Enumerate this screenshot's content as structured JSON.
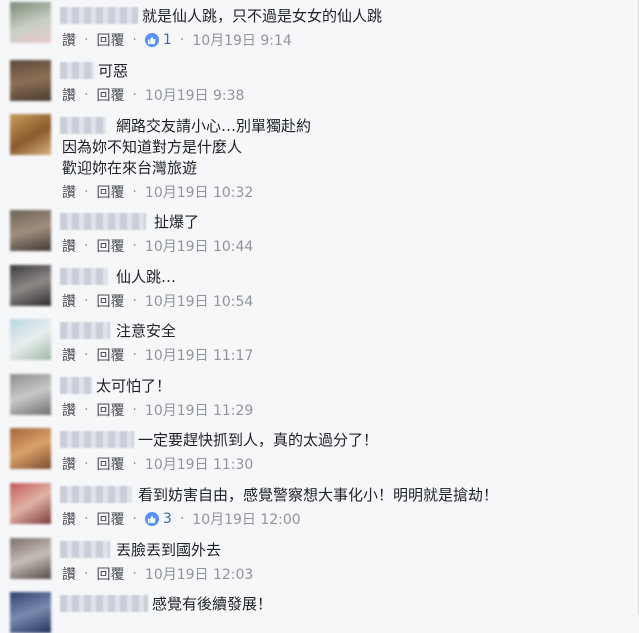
{
  "actions": {
    "like_label": "讚",
    "reply_label": "回覆",
    "separator": "·"
  },
  "comments": [
    {
      "text": "就是仙人跳，只不過是女女的仙人跳",
      "likes": "1",
      "time": "10月19日 9:14"
    },
    {
      "text": "可惡",
      "time": "10月19日 9:38"
    },
    {
      "text": "網路交友請小心…別單獨赴約",
      "text2": "因為妳不知道對方是什麼人",
      "text3": "歡迎妳在來台灣旅遊",
      "time": "10月19日 10:32"
    },
    {
      "text": "扯爆了",
      "time": "10月19日 10:44"
    },
    {
      "text": "仙人跳…",
      "time": "10月19日 10:54"
    },
    {
      "text": "注意安全",
      "time": "10月19日 11:17"
    },
    {
      "text": "太可怕了！",
      "time": "10月19日 11:29"
    },
    {
      "text": "一定要趕快抓到人，真的太過分了！",
      "time": "10月19日 11:30"
    },
    {
      "text": "看到妨害自由，感覺警察想大事化小！明明就是搶劫！",
      "likes": "3",
      "time": "10月19日 12:00"
    },
    {
      "text": "丟臉丟到國外去",
      "time": "10月19日 12:03"
    },
    {
      "text": "感覺有後續發展！"
    }
  ]
}
